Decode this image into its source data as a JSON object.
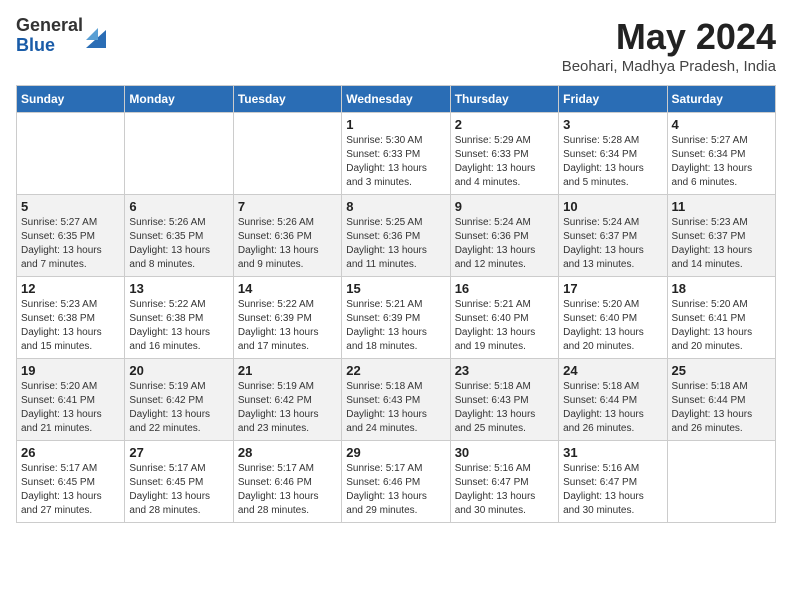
{
  "header": {
    "logo_general": "General",
    "logo_blue": "Blue",
    "month_title": "May 2024",
    "location": "Beohari, Madhya Pradesh, India"
  },
  "weekdays": [
    "Sunday",
    "Monday",
    "Tuesday",
    "Wednesday",
    "Thursday",
    "Friday",
    "Saturday"
  ],
  "weeks": [
    [
      {
        "day": "",
        "info": ""
      },
      {
        "day": "",
        "info": ""
      },
      {
        "day": "",
        "info": ""
      },
      {
        "day": "1",
        "info": "Sunrise: 5:30 AM\nSunset: 6:33 PM\nDaylight: 13 hours and 3 minutes."
      },
      {
        "day": "2",
        "info": "Sunrise: 5:29 AM\nSunset: 6:33 PM\nDaylight: 13 hours and 4 minutes."
      },
      {
        "day": "3",
        "info": "Sunrise: 5:28 AM\nSunset: 6:34 PM\nDaylight: 13 hours and 5 minutes."
      },
      {
        "day": "4",
        "info": "Sunrise: 5:27 AM\nSunset: 6:34 PM\nDaylight: 13 hours and 6 minutes."
      }
    ],
    [
      {
        "day": "5",
        "info": "Sunrise: 5:27 AM\nSunset: 6:35 PM\nDaylight: 13 hours and 7 minutes."
      },
      {
        "day": "6",
        "info": "Sunrise: 5:26 AM\nSunset: 6:35 PM\nDaylight: 13 hours and 8 minutes."
      },
      {
        "day": "7",
        "info": "Sunrise: 5:26 AM\nSunset: 6:36 PM\nDaylight: 13 hours and 9 minutes."
      },
      {
        "day": "8",
        "info": "Sunrise: 5:25 AM\nSunset: 6:36 PM\nDaylight: 13 hours and 11 minutes."
      },
      {
        "day": "9",
        "info": "Sunrise: 5:24 AM\nSunset: 6:36 PM\nDaylight: 13 hours and 12 minutes."
      },
      {
        "day": "10",
        "info": "Sunrise: 5:24 AM\nSunset: 6:37 PM\nDaylight: 13 hours and 13 minutes."
      },
      {
        "day": "11",
        "info": "Sunrise: 5:23 AM\nSunset: 6:37 PM\nDaylight: 13 hours and 14 minutes."
      }
    ],
    [
      {
        "day": "12",
        "info": "Sunrise: 5:23 AM\nSunset: 6:38 PM\nDaylight: 13 hours and 15 minutes."
      },
      {
        "day": "13",
        "info": "Sunrise: 5:22 AM\nSunset: 6:38 PM\nDaylight: 13 hours and 16 minutes."
      },
      {
        "day": "14",
        "info": "Sunrise: 5:22 AM\nSunset: 6:39 PM\nDaylight: 13 hours and 17 minutes."
      },
      {
        "day": "15",
        "info": "Sunrise: 5:21 AM\nSunset: 6:39 PM\nDaylight: 13 hours and 18 minutes."
      },
      {
        "day": "16",
        "info": "Sunrise: 5:21 AM\nSunset: 6:40 PM\nDaylight: 13 hours and 19 minutes."
      },
      {
        "day": "17",
        "info": "Sunrise: 5:20 AM\nSunset: 6:40 PM\nDaylight: 13 hours and 20 minutes."
      },
      {
        "day": "18",
        "info": "Sunrise: 5:20 AM\nSunset: 6:41 PM\nDaylight: 13 hours and 20 minutes."
      }
    ],
    [
      {
        "day": "19",
        "info": "Sunrise: 5:20 AM\nSunset: 6:41 PM\nDaylight: 13 hours and 21 minutes."
      },
      {
        "day": "20",
        "info": "Sunrise: 5:19 AM\nSunset: 6:42 PM\nDaylight: 13 hours and 22 minutes."
      },
      {
        "day": "21",
        "info": "Sunrise: 5:19 AM\nSunset: 6:42 PM\nDaylight: 13 hours and 23 minutes."
      },
      {
        "day": "22",
        "info": "Sunrise: 5:18 AM\nSunset: 6:43 PM\nDaylight: 13 hours and 24 minutes."
      },
      {
        "day": "23",
        "info": "Sunrise: 5:18 AM\nSunset: 6:43 PM\nDaylight: 13 hours and 25 minutes."
      },
      {
        "day": "24",
        "info": "Sunrise: 5:18 AM\nSunset: 6:44 PM\nDaylight: 13 hours and 26 minutes."
      },
      {
        "day": "25",
        "info": "Sunrise: 5:18 AM\nSunset: 6:44 PM\nDaylight: 13 hours and 26 minutes."
      }
    ],
    [
      {
        "day": "26",
        "info": "Sunrise: 5:17 AM\nSunset: 6:45 PM\nDaylight: 13 hours and 27 minutes."
      },
      {
        "day": "27",
        "info": "Sunrise: 5:17 AM\nSunset: 6:45 PM\nDaylight: 13 hours and 28 minutes."
      },
      {
        "day": "28",
        "info": "Sunrise: 5:17 AM\nSunset: 6:46 PM\nDaylight: 13 hours and 28 minutes."
      },
      {
        "day": "29",
        "info": "Sunrise: 5:17 AM\nSunset: 6:46 PM\nDaylight: 13 hours and 29 minutes."
      },
      {
        "day": "30",
        "info": "Sunrise: 5:16 AM\nSunset: 6:47 PM\nDaylight: 13 hours and 30 minutes."
      },
      {
        "day": "31",
        "info": "Sunrise: 5:16 AM\nSunset: 6:47 PM\nDaylight: 13 hours and 30 minutes."
      },
      {
        "day": "",
        "info": ""
      }
    ]
  ]
}
